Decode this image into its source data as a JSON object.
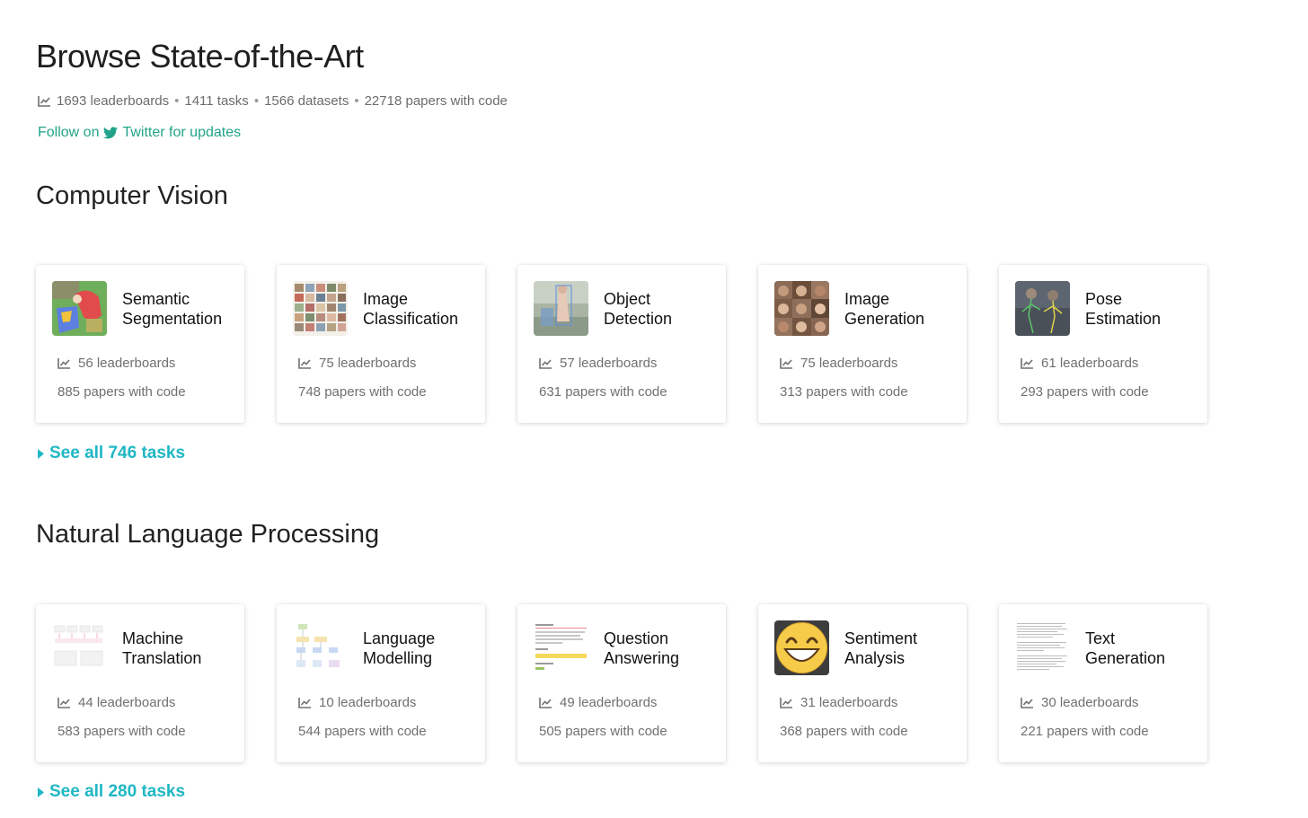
{
  "page": {
    "title": "Browse State-of-the-Art",
    "stats": [
      "1693 leaderboards",
      "1411 tasks",
      "1566 datasets",
      "22718 papers with code"
    ],
    "stats_separator": "•",
    "follow_prefix": "Follow on",
    "follow_link": "Twitter for updates"
  },
  "colors": {
    "link": "#21a389",
    "see_all": "#1fb7c4",
    "muted": "#707070"
  },
  "sections": [
    {
      "title": "Computer Vision",
      "see_all": "See all 746 tasks",
      "cards": [
        {
          "title_line1": "Semantic",
          "title_line2": "Segmentation",
          "leaderboards": "56 leaderboards",
          "papers": "885 papers with code"
        },
        {
          "title_line1": "Image",
          "title_line2": "Classification",
          "leaderboards": "75 leaderboards",
          "papers": "748 papers with code"
        },
        {
          "title_line1": "Object",
          "title_line2": "Detection",
          "leaderboards": "57 leaderboards",
          "papers": "631 papers with code"
        },
        {
          "title_line1": "Image",
          "title_line2": "Generation",
          "leaderboards": "75 leaderboards",
          "papers": "313 papers with code"
        },
        {
          "title_line1": "Pose",
          "title_line2": "Estimation",
          "leaderboards": "61 leaderboards",
          "papers": "293 papers with code"
        }
      ]
    },
    {
      "title": "Natural Language Processing",
      "see_all": "See all 280 tasks",
      "cards": [
        {
          "title_line1": "Machine",
          "title_line2": "Translation",
          "leaderboards": "44 leaderboards",
          "papers": "583 papers with code"
        },
        {
          "title_line1": "Language",
          "title_line2": "Modelling",
          "leaderboards": "10 leaderboards",
          "papers": "544 papers with code"
        },
        {
          "title_line1": "Question",
          "title_line2": "Answering",
          "leaderboards": "49 leaderboards",
          "papers": "505 papers with code"
        },
        {
          "title_line1": "Sentiment",
          "title_line2": "Analysis",
          "leaderboards": "31 leaderboards",
          "papers": "368 papers with code"
        },
        {
          "title_line1": "Text",
          "title_line2": "Generation",
          "leaderboards": "30 leaderboards",
          "papers": "221 papers with code"
        }
      ]
    }
  ]
}
